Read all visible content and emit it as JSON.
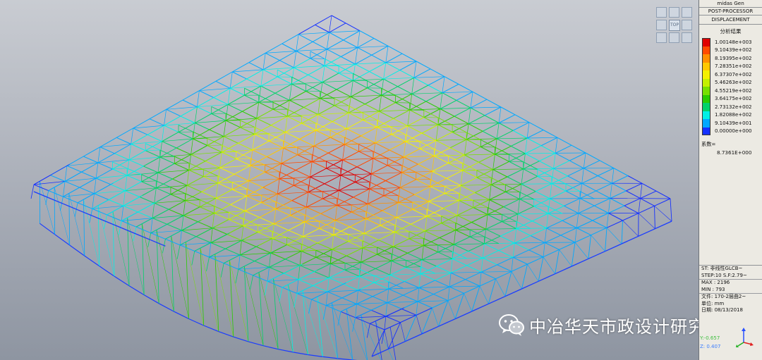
{
  "panel": {
    "app_name": "midas Gen",
    "module": "POST-PROCESSOR",
    "result_type": "DISPLACEMENT",
    "result_label": "分析结果",
    "legend": [
      {
        "value": "1.00148e+003",
        "color": "#e00000"
      },
      {
        "value": "9.10439e+002",
        "color": "#ff4a00"
      },
      {
        "value": "8.19395e+002",
        "color": "#ff8f00"
      },
      {
        "value": "7.28351e+002",
        "color": "#ffc800"
      },
      {
        "value": "6.37307e+002",
        "color": "#f4f000"
      },
      {
        "value": "5.46263e+002",
        "color": "#c4f000"
      },
      {
        "value": "4.55219e+002",
        "color": "#78e000"
      },
      {
        "value": "3.64175e+002",
        "color": "#2acc00"
      },
      {
        "value": "2.73132e+002",
        "color": "#00d26a"
      },
      {
        "value": "1.82088e+002",
        "color": "#00f0e6"
      },
      {
        "value": "9.10439e+001",
        "color": "#00a8ff"
      },
      {
        "value": "0.00000e+000",
        "color": "#1430ff"
      }
    ],
    "factor_label": "系数=",
    "factor_value": "8.7361E+000",
    "info": {
      "st": "ST: 非线性GLCB~",
      "step": "STEP:10 S.F:2.79~",
      "max": "MAX : 2196",
      "min": "MIN : 793",
      "file": "文件: 170-2层曲2~",
      "unit": "单位: mm",
      "date": "日期: 08/13/2018"
    }
  },
  "view_cube": {
    "label": "TOP"
  },
  "axis": {
    "y": "Y:-0.657",
    "z": "Z: 0.407"
  },
  "watermark": {
    "text": "中冶华天市政设计研究院"
  }
}
